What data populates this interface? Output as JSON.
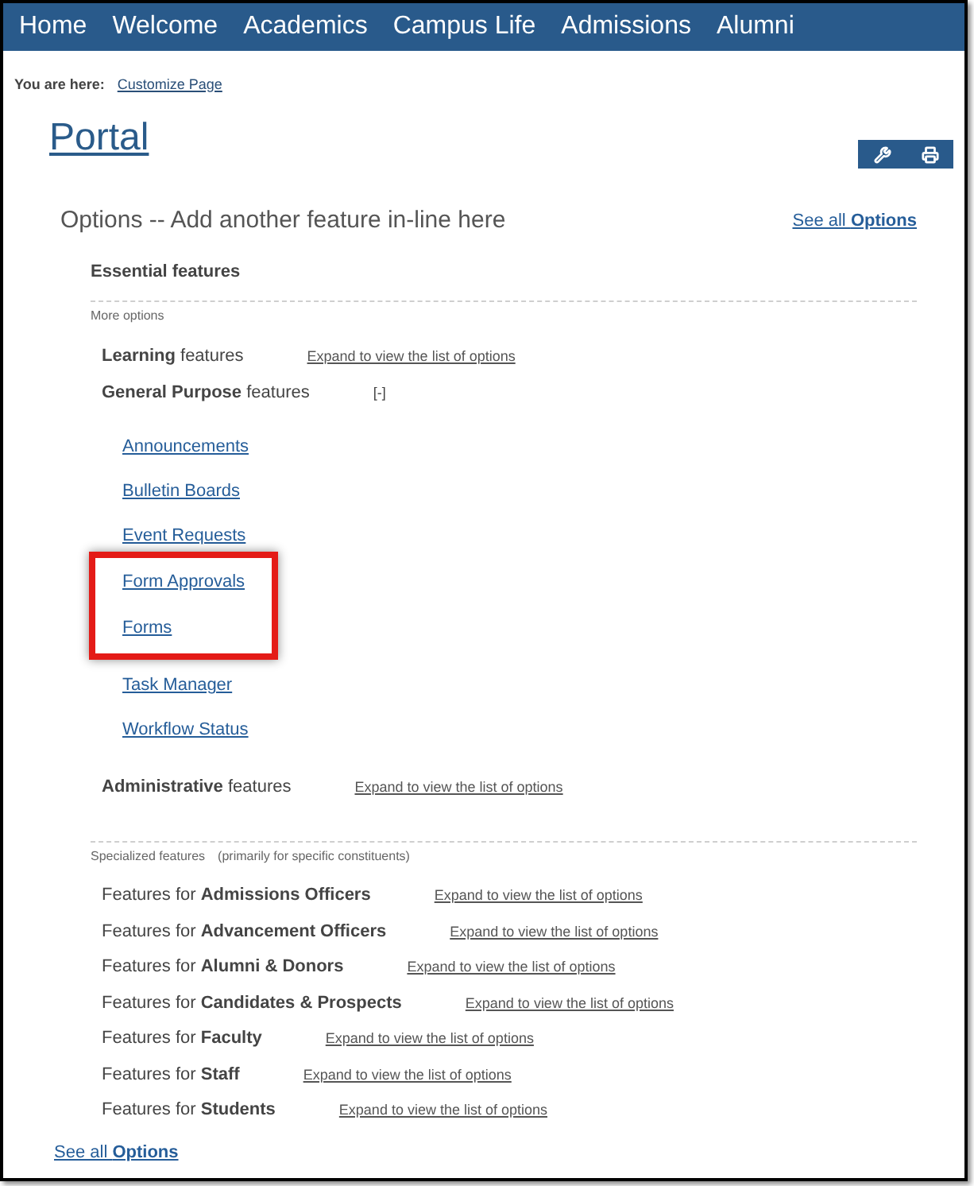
{
  "nav": {
    "items": [
      "Home",
      "Welcome",
      "Academics",
      "Campus Life",
      "Admissions",
      "Alumni"
    ]
  },
  "breadcrumb": {
    "label": "You are here:",
    "links": [
      "Customize Page"
    ]
  },
  "page": {
    "title": "Portal"
  },
  "options": {
    "heading": "Options -- Add another feature in-line here",
    "see_all": "See all **Options**",
    "essential": {
      "heading": "Essential features",
      "subheading": "More options",
      "groups": [
        {
          "label": "**Learning** features",
          "expanded": false,
          "toggle": "Expand to view the list of options"
        },
        {
          "label": "**General Purpose** features",
          "expanded": true,
          "toggle": "[-]",
          "items": [
            {
              "label": "Announcements",
              "highlighted": false
            },
            {
              "label": "Bulletin Boards",
              "highlighted": false
            },
            {
              "label": "Event Requests",
              "highlighted": false
            },
            {
              "label": "Form Approvals",
              "highlighted": true
            },
            {
              "label": "Forms",
              "highlighted": true
            },
            {
              "label": "Task Manager",
              "highlighted": false
            },
            {
              "label": "Workflow Status",
              "highlighted": false
            }
          ]
        },
        {
          "label": "**Administrative** features",
          "expanded": false,
          "toggle": "Expand to view the list of options"
        }
      ]
    },
    "specialized": {
      "heading": "Specialized features",
      "note": "(primarily for specific constituents)",
      "groups": [
        {
          "label": "Features for **Admissions Officers**",
          "expanded": false,
          "toggle": "Expand to view the list of options"
        },
        {
          "label": "Features for **Advancement Officers**",
          "expanded": false,
          "toggle": "Expand to view the list of options"
        },
        {
          "label": "Features for **Alumni & Donors**",
          "expanded": false,
          "toggle": "Expand to view the list of options"
        },
        {
          "label": "Features for **Candidates & Prospects**",
          "expanded": false,
          "toggle": "Expand to view the list of options"
        },
        {
          "label": "Features for **Faculty**",
          "expanded": false,
          "toggle": "Expand to view the list of options"
        },
        {
          "label": "Features for **Staff**",
          "expanded": false,
          "toggle": "Expand to view the list of options"
        },
        {
          "label": "Features for **Students**",
          "expanded": false,
          "toggle": "Expand to view the list of options"
        }
      ]
    },
    "footer_link": "See all **Options**"
  }
}
